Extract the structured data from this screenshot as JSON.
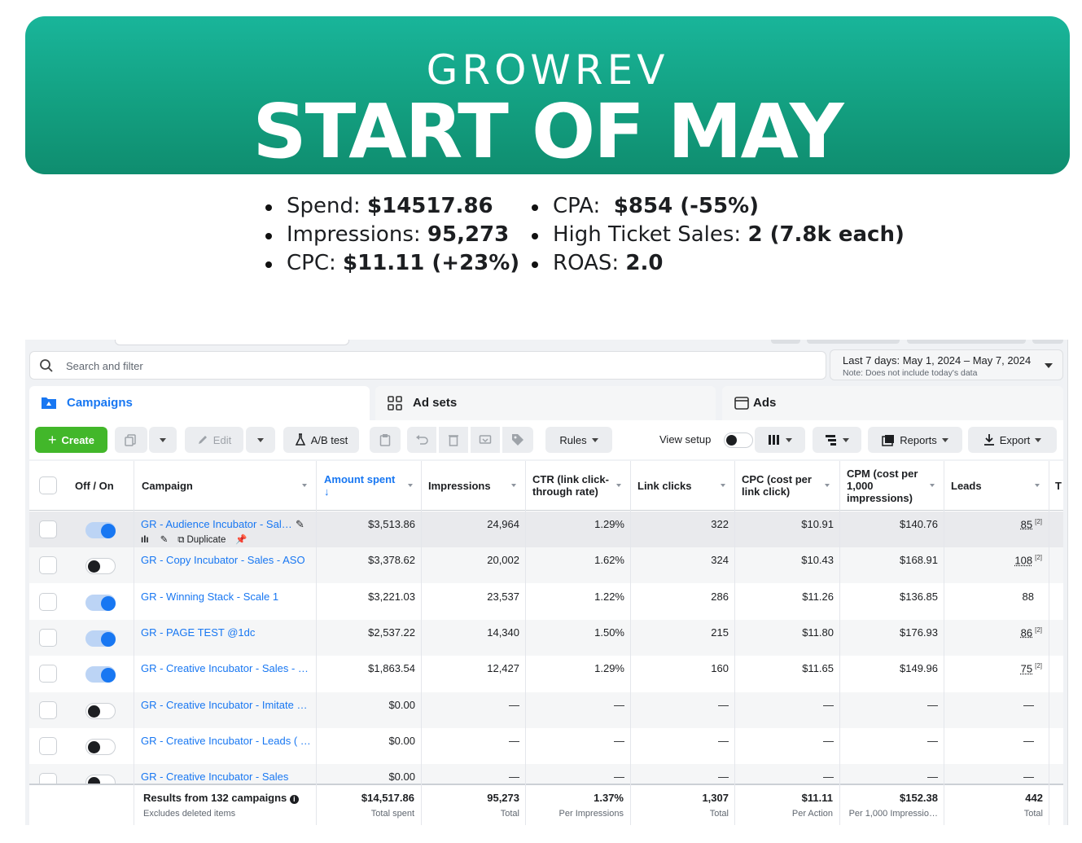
{
  "banner": {
    "brand": "GROWREV",
    "headline": "START OF MAY"
  },
  "stats_left": [
    {
      "label": "Spend: ",
      "value": "$14517.86"
    },
    {
      "label": "Impressions: ",
      "value": "95,273"
    },
    {
      "label": "CPC: ",
      "value": "$11.11 (+23%)"
    }
  ],
  "stats_right": [
    {
      "label": "CPA:  ",
      "value": "$854 (-55%)"
    },
    {
      "label": "High Ticket Sales: ",
      "value": "2 (7.8k each)"
    },
    {
      "label": "ROAS: ",
      "value": "2.0"
    }
  ],
  "search": {
    "placeholder": "Search and filter"
  },
  "date_range": {
    "label": "Last 7 days: May 1, 2024 – May 7, 2024",
    "note": "Note: Does not include today's data"
  },
  "tabs": {
    "campaigns": "Campaigns",
    "ad_sets": "Ad sets",
    "ads": "Ads"
  },
  "toolbar": {
    "create": "Create",
    "edit": "Edit",
    "ab_test": "A/B test",
    "rules": "Rules",
    "view_setup": "View setup",
    "reports": "Reports",
    "export": "Export"
  },
  "columns": {
    "off_on": "Off / On",
    "campaign": "Campaign",
    "amount_spent": "Amount spent",
    "impressions": "Impressions",
    "ctr": "CTR (link click-through rate)",
    "link_clicks": "Link clicks",
    "cpc": "CPC (cost per link click)",
    "cpm": "CPM (cost per 1,000 impressions)",
    "leads": "Leads",
    "more": "T"
  },
  "row_actions": {
    "duplicate": "Duplicate"
  },
  "rows": [
    {
      "on": true,
      "campaign": "GR - Audience Incubator - Sal…",
      "spent": "$3,513.86",
      "impressions": "24,964",
      "ctr": "1.29%",
      "clicks": "322",
      "cpc": "$10.91",
      "cpm": "$140.76",
      "leads": "85",
      "leads_note": "[2]"
    },
    {
      "on": false,
      "campaign": "GR - Copy Incubator - Sales - ASO",
      "spent": "$3,378.62",
      "impressions": "20,002",
      "ctr": "1.62%",
      "clicks": "324",
      "cpc": "$10.43",
      "cpm": "$168.91",
      "leads": "108",
      "leads_note": "[2]"
    },
    {
      "on": true,
      "campaign": "GR - Winning Stack - Scale 1",
      "spent": "$3,221.03",
      "impressions": "23,537",
      "ctr": "1.22%",
      "clicks": "286",
      "cpc": "$11.26",
      "cpm": "$136.85",
      "leads": "88",
      "leads_note": ""
    },
    {
      "on": true,
      "campaign": "GR - PAGE TEST @1dc",
      "spent": "$2,537.22",
      "impressions": "14,340",
      "ctr": "1.50%",
      "clicks": "215",
      "cpc": "$11.80",
      "cpm": "$176.93",
      "leads": "86",
      "leads_note": "[2]"
    },
    {
      "on": true,
      "campaign": "GR - Creative Incubator - Sales - …",
      "spent": "$1,863.54",
      "impressions": "12,427",
      "ctr": "1.29%",
      "clicks": "160",
      "cpc": "$11.65",
      "cpm": "$149.96",
      "leads": "75",
      "leads_note": "[2]"
    },
    {
      "on": false,
      "campaign": "GR - Creative Incubator - Imitate …",
      "spent": "$0.00",
      "impressions": "—",
      "ctr": "—",
      "clicks": "—",
      "cpc": "—",
      "cpm": "—",
      "leads": "—",
      "leads_note": ""
    },
    {
      "on": false,
      "campaign": "GR - Creative Incubator - Leads ( …",
      "spent": "$0.00",
      "impressions": "—",
      "ctr": "—",
      "clicks": "—",
      "cpc": "—",
      "cpm": "—",
      "leads": "—",
      "leads_note": ""
    },
    {
      "on": false,
      "campaign": "GR - Creative Incubator - Sales",
      "spent": "$0.00",
      "impressions": "—",
      "ctr": "—",
      "clicks": "—",
      "cpc": "—",
      "cpm": "—",
      "leads": "—",
      "leads_note": ""
    }
  ],
  "totals": {
    "label": "Results from 132 campaigns",
    "sublabel": "Excludes deleted items",
    "spent": "$14,517.86",
    "spent_sub": "Total spent",
    "impressions": "95,273",
    "impressions_sub": "Total",
    "ctr": "1.37%",
    "ctr_sub": "Per Impressions",
    "clicks": "1,307",
    "clicks_sub": "Total",
    "cpc": "$11.11",
    "cpc_sub": "Per Action",
    "cpm": "$152.38",
    "cpm_sub": "Per 1,000 Impressio…",
    "leads": "442",
    "leads_sub": "Total"
  },
  "colors": {
    "banner": "#13a081",
    "accent_blue": "#1877f2",
    "create_green": "#42b72a"
  }
}
